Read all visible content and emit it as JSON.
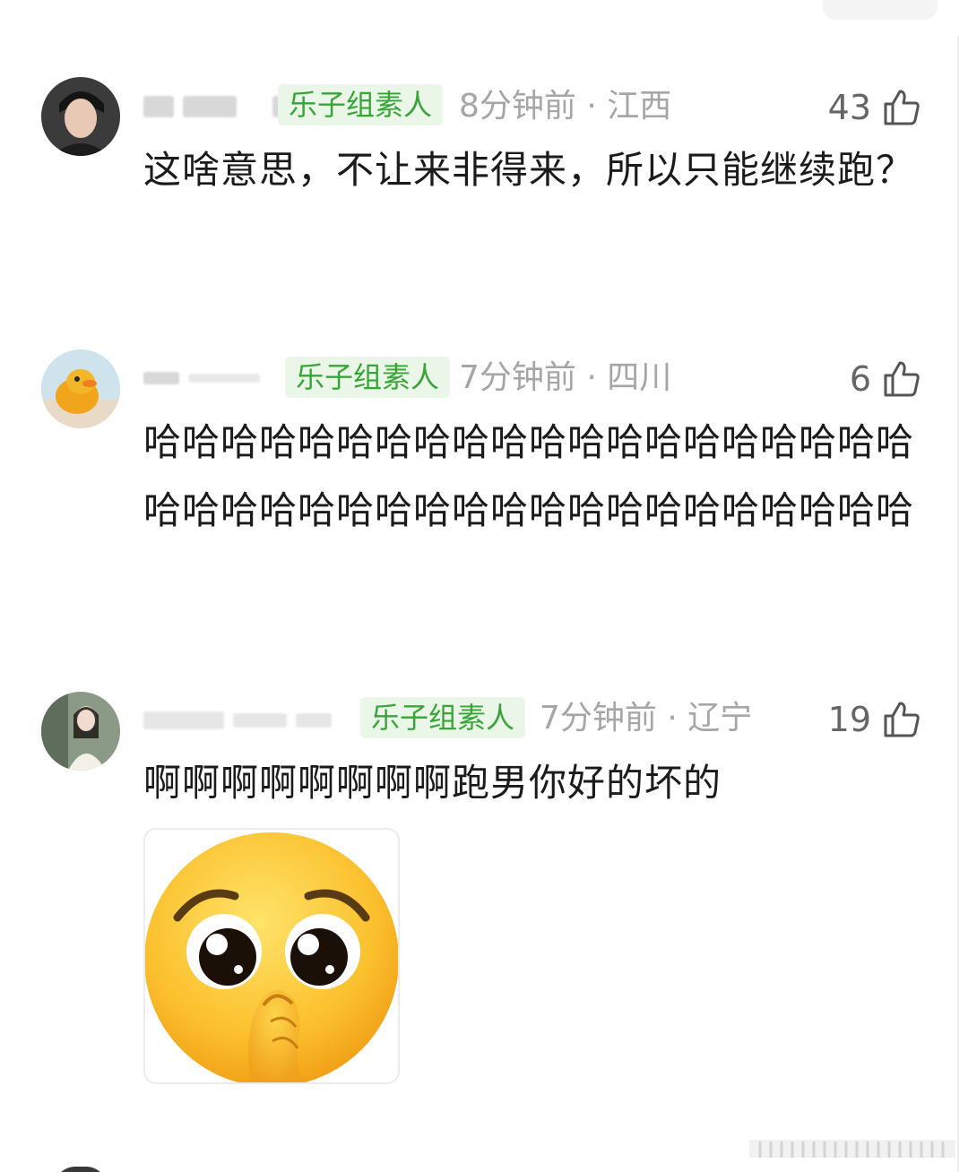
{
  "comments": [
    {
      "badge": "乐子组素人",
      "time": "8分钟前",
      "location": "江西",
      "meta": "8分钟前 · 江西",
      "likes": "43",
      "text": "这啥意思，不让来非得来，所以只能继续跑？",
      "icon": "like-icon"
    },
    {
      "badge": "乐子组素人",
      "time": "7分钟前",
      "location": "四川",
      "meta": "7分钟前 · 四川",
      "likes": "6",
      "text": "哈哈哈哈哈哈哈哈哈哈哈哈哈哈哈哈哈哈哈哈哈哈哈哈哈哈哈哈哈哈哈哈哈哈哈哈哈哈哈哈",
      "icon": "like-icon"
    },
    {
      "badge": "乐子组素人",
      "time": "7分钟前",
      "location": "辽宁",
      "meta": "7分钟前 · 辽宁",
      "likes": "19",
      "text": "啊啊啊啊啊啊啊啊跑男你好的坏的",
      "icon": "like-icon",
      "attachment": "pleading-emoji-sticker"
    }
  ],
  "colors": {
    "badge_bg": "#eaf6e7",
    "badge_text": "#39a43a",
    "meta_text": "#a6a6a6",
    "body_text": "#1b1b1b"
  }
}
